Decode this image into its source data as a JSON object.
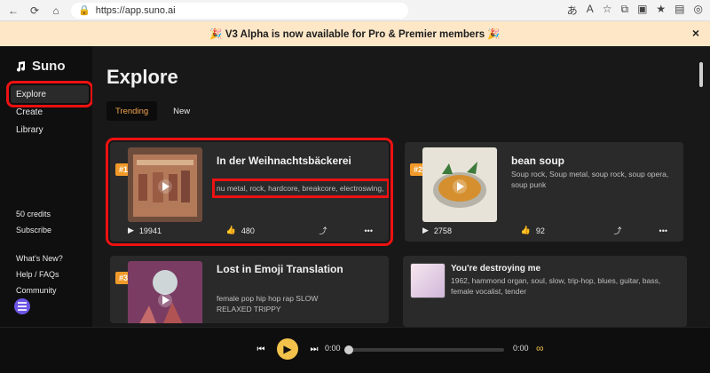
{
  "browser": {
    "url": "https://app.suno.ai",
    "icons": [
      "back-icon",
      "refresh-icon",
      "home-icon",
      "lock-icon"
    ],
    "right_icons": [
      "translate-icon",
      "read-aloud-icon",
      "star-icon",
      "extensions-icon",
      "split-screen-icon",
      "favorites-icon",
      "collections-icon",
      "copilot-icon"
    ]
  },
  "banner": {
    "text": "🎉 V3 Alpha is now available for Pro & Premier members 🎉",
    "close": "×"
  },
  "sidebar": {
    "logo": "Suno",
    "items": [
      {
        "label": "Explore"
      },
      {
        "label": "Create"
      },
      {
        "label": "Library"
      }
    ],
    "credits": "50 credits",
    "subscribe": "Subscribe",
    "links": [
      "What's New?",
      "Help / FAQs",
      "Community"
    ]
  },
  "main": {
    "title": "Explore",
    "tabs": [
      "Trending",
      "New"
    ]
  },
  "cards": [
    {
      "rank": "#1",
      "title": "In der Weihnachtsbäckerei",
      "tags": "nu metal, rock, hardcore, breakcore, electroswing,",
      "plays": "19941",
      "likes": "480"
    },
    {
      "rank": "#2",
      "title": "bean soup",
      "tags": "Soup rock, Soup metal, soup rock, soup opera, soup punk",
      "plays": "2758",
      "likes": "92"
    },
    {
      "rank": "#3",
      "title": "Lost in Emoji Translation",
      "tags": "female pop hip hop rap SLOW",
      "tags2": "RELAXED TRIPPY"
    },
    {
      "title": "You're destroying me",
      "tags": "1962, hammond organ, soul, slow, trip-hop, blues, guitar, bass, female vocalist, tender"
    }
  ],
  "player": {
    "current_time": "0:00",
    "duration": "0:00"
  }
}
